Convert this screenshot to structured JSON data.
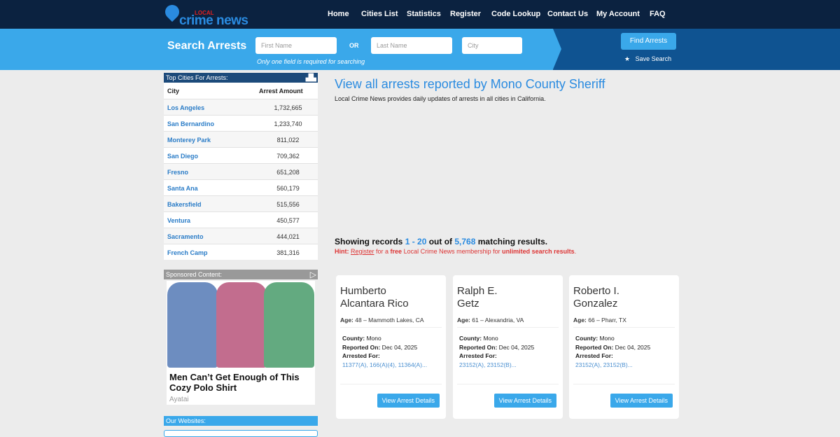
{
  "header": {
    "logo_small": "LOCAL",
    "logo_text": "crime news",
    "nav": [
      "Home",
      "Cities List",
      "Statistics",
      "Register",
      "Code Lookup",
      "Contact Us",
      "My Account",
      "FAQ"
    ]
  },
  "search": {
    "title": "Search Arrests",
    "first_placeholder": "First Name",
    "or": "OR",
    "last_placeholder": "Last Name",
    "city_placeholder": "City",
    "hint": "Only one field is required for searching",
    "find_label": "Find Arrests",
    "save_label": "Save Search"
  },
  "sidebar": {
    "top_title": "Top Cities For Arrests:",
    "col_city": "City",
    "col_amount": "Arrest Amount",
    "cities": [
      {
        "city": "Los Angeles",
        "amount": "1,732,665"
      },
      {
        "city": "San Bernardino",
        "amount": "1,233,740"
      },
      {
        "city": "Monterey Park",
        "amount": "811,022"
      },
      {
        "city": "San Diego",
        "amount": "709,362"
      },
      {
        "city": "Fresno",
        "amount": "651,208"
      },
      {
        "city": "Santa Ana",
        "amount": "560,179"
      },
      {
        "city": "Bakersfield",
        "amount": "515,556"
      },
      {
        "city": "Ventura",
        "amount": "450,577"
      },
      {
        "city": "Sacramento",
        "amount": "444,021"
      },
      {
        "city": "French Camp",
        "amount": "381,316"
      }
    ],
    "sponsored_title": "Sponsored Content:",
    "ad_headline": "Men Can’t Get Enough of This Cozy Polo Shirt",
    "ad_source": "Ayatai",
    "websites_title": "Our Websites:"
  },
  "main": {
    "title": "View all arrests reported by Mono County Sheriff",
    "subtitle": "Local Crime News provides daily updates of arrests in all cities in California.",
    "showing_pre": "Showing records ",
    "range": "1 - 20",
    "out_of": " out of ",
    "total": "5,768",
    "showing_post": " matching results.",
    "hint_label": "Hint:",
    "hint_register": "Register",
    "hint_mid": " for a ",
    "hint_free": "free",
    "hint_mid2": " Local Crime News membership for ",
    "hint_unlimited": "unlimited search results",
    "hint_end": ".",
    "labels": {
      "age": "Age:",
      "county": "County:",
      "reported": "Reported On:",
      "arrested": "Arrested For:",
      "button": "View Arrest Details"
    },
    "cards": [
      {
        "name1": "Humberto",
        "name2": "Alcantara Rico",
        "age": " 48 – Mammoth Lakes, CA",
        "county": " Mono",
        "reported": " Dec 04, 2025",
        "charges": "11377(A), 166(A)(4), 11364(A)..."
      },
      {
        "name1": "Ralph E.",
        "name2": "Getz",
        "age": " 61 – Alexandria, VA",
        "county": " Mono",
        "reported": " Dec 04, 2025",
        "charges": "23152(A), 23152(B)..."
      },
      {
        "name1": "Roberto I.",
        "name2": "Gonzalez",
        "age": " 66 – Pharr, TX",
        "county": " Mono",
        "reported": " Dec 04, 2025",
        "charges": "23152(A), 23152(B)..."
      }
    ]
  },
  "colors": {
    "navy": "#0b2240",
    "accent": "#3aa8ea",
    "dark_blue": "#0f5391",
    "link": "#2a8be0",
    "hint_red": "#dd3333"
  }
}
